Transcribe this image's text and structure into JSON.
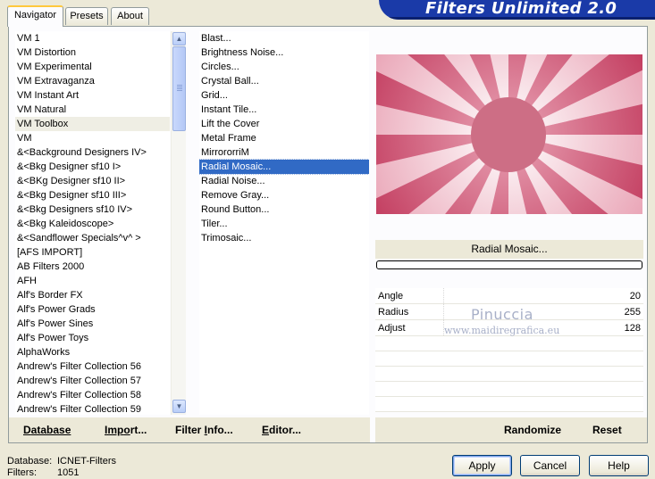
{
  "app": {
    "title": "Filters Unlimited 2.0"
  },
  "tabs": [
    {
      "label": "Navigator",
      "active": true
    },
    {
      "label": "Presets",
      "active": false
    },
    {
      "label": "About",
      "active": false
    }
  ],
  "categories": {
    "selected": "VM Toolbox",
    "items": [
      "VM 1",
      "VM Distortion",
      "VM Experimental",
      "VM Extravaganza",
      "VM Instant Art",
      "VM Natural",
      "VM Toolbox",
      "VM",
      "&<Background Designers IV>",
      "&<Bkg Designer sf10 I>",
      "&<BKg Designer sf10 II>",
      "&<Bkg Designer sf10 III>",
      "&<Bkg Designers sf10 IV>",
      "&<Bkg Kaleidoscope>",
      "&<Sandflower Specials^v^ >",
      "[AFS IMPORT]",
      "AB Filters 2000",
      "AFH",
      "Alf's Border FX",
      "Alf's Power Grads",
      "Alf's Power Sines",
      "Alf's Power Toys",
      "AlphaWorks",
      "Andrew's Filter Collection 56",
      "Andrew's Filter Collection 57",
      "Andrew's Filter Collection 58",
      "Andrew's Filter Collection 59"
    ]
  },
  "filters": {
    "selected": "Radial Mosaic...",
    "items": [
      "Blast...",
      "Brightness Noise...",
      "Circles...",
      "Crystal Ball...",
      "Grid...",
      "Instant Tile...",
      "Lift the Cover",
      "Metal Frame",
      "MirrororriM",
      "Radial Mosaic...",
      "Radial Noise...",
      "Remove Gray...",
      "Round Button...",
      "Tiler...",
      "Trimosaic..."
    ]
  },
  "preview": {
    "filter_name": "Radial Mosaic...",
    "colors": {
      "dark": "#c23b5e",
      "mid": "#e9a3b5",
      "light": "#ffffff",
      "center": "#cd6e85"
    },
    "progress_percent": 0
  },
  "params": [
    {
      "name": "Angle",
      "value": "20"
    },
    {
      "name": "Radius",
      "value": "255"
    },
    {
      "name": "Adjust",
      "value": "128"
    }
  ],
  "watermark": {
    "line1": "Pinuccia",
    "line2": "www.maidiregrafica.eu"
  },
  "bottom_links": {
    "database": {
      "u": "D",
      "rest": "atabase"
    },
    "import": {
      "pre": "Imp",
      "u": "o",
      "rest": "rt..."
    },
    "filter_info": {
      "pre": "Filter ",
      "u": "I",
      "rest": "nfo..."
    },
    "editor": {
      "u": "E",
      "rest": "ditor..."
    },
    "randomize": "Randomize",
    "reset": "Reset"
  },
  "status": {
    "database_label": "Database:",
    "database_value": "ICNET-Filters",
    "filters_label": "Filters:",
    "filters_value": "1051"
  },
  "buttons": {
    "apply": "Apply",
    "cancel": "Cancel",
    "help": "Help"
  }
}
